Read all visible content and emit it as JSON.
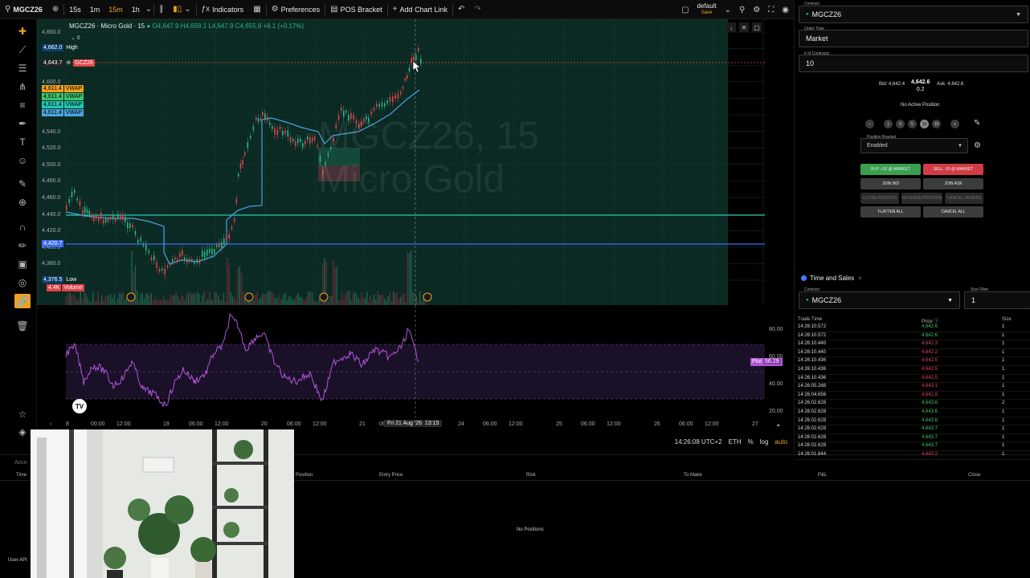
{
  "toolbar": {
    "symbol": "MGCZ26",
    "timeframes": [
      "15s",
      "1m",
      "15m",
      "1h"
    ],
    "active_timeframe": "15m",
    "indicators_label": "Indicators",
    "preferences_label": "Preferences",
    "pos_bracket_label": "POS Bracket",
    "add_chart_link_label": "Add Chart Link",
    "layout_name": "default",
    "layout_sub": "Save"
  },
  "chart": {
    "symbol_title": "MGCZ26 · Micro Gold · 15",
    "ohlc": "O4,647.9 H4,659.1 L4,647.9 C4,655.8 +8.1 (+0.17%)",
    "sub_count": "6",
    "watermark_line1": "MGCZ26, 15",
    "watermark_line2": "Micro Gold",
    "price_labels": [
      "4,660.0",
      "4,640.0",
      "4,620.0",
      "4,600.0",
      "4,580.0",
      "4,560.0",
      "4,540.0",
      "4,520.0",
      "4,500.0",
      "4,480.0",
      "4,460.0",
      "4,440.0",
      "4,420.0",
      "4,400.0",
      "4,380.0",
      "4,360.0"
    ],
    "tags": {
      "high": {
        "value": "4,662.0",
        "name": "High"
      },
      "current": {
        "value": "4,643.7",
        "name": "GCZ26"
      },
      "vwap1": {
        "value": "4,611.4",
        "name": "VWAP"
      },
      "vwap2": {
        "value": "4,611.4",
        "name": "VWAP"
      },
      "vwap3": {
        "value": "4,611.4",
        "name": "VWAP"
      },
      "vwap4": {
        "value": "4,611.4",
        "name": "VWAP"
      },
      "level": {
        "value": "4,420.7"
      },
      "low": {
        "value": "4,376.5",
        "name": "Low"
      },
      "volume": {
        "value": "4.4K",
        "name": "Volume"
      }
    },
    "colors": {
      "background": "#0c2a24",
      "up": "#2db58a",
      "down": "#e0444c",
      "vwap": "#4aa3df",
      "level_teal": "#26c6b0",
      "level_blue": "#3b6cf0"
    }
  },
  "rsi": {
    "labels": [
      "80.00",
      "60.00",
      "40.00",
      "20.00"
    ],
    "plot_label": "Plot",
    "plot_value": "56.29",
    "color": "#b057d8"
  },
  "time_axis": {
    "labels": [
      "8",
      "00:00",
      "12:00",
      "19",
      "06:00",
      "12:00",
      "20",
      "06:00",
      "12:00",
      "21",
      "06",
      "24",
      "06:00",
      "12:00",
      "25",
      "06:00",
      "12:00",
      "26",
      "06:00",
      "12:00",
      "27"
    ],
    "crosshair_date": "Fri 21 Aug '26",
    "crosshair_time": "13:15"
  },
  "status_bar": {
    "clock": "14:26:08 UTC+2",
    "session": "ETH",
    "percent": "%",
    "log": "log",
    "auto": "auto"
  },
  "order_panel": {
    "contract_label": "Contract",
    "contract_value": "MGCZ26",
    "order_type_label": "Order Type",
    "order_type_value": "Market",
    "contracts_label": "# of Contracts",
    "contracts_value": "10",
    "bid": "Bid: 4,642.4",
    "ask": "Ask: 4,642.6",
    "last_price": "4,642.6",
    "last_size": "0.2",
    "no_active_position": "No Active Position",
    "quantities": [
      "1",
      "3",
      "5",
      "10",
      "15"
    ],
    "selected_quantity": "10",
    "position_bracket_label": "Position Bracket",
    "position_bracket_value": "Enabled",
    "buy_label": "BUY +10 @ MARKET",
    "sell_label": "SELL -10 @ MARKET",
    "join_bid": "JOIN BID",
    "join_ask": "JOIN ASK",
    "close_position": "CLOSE POSITION",
    "reverse_position": "REVERSE POSITION",
    "cancel_orders": "CANCEL ORDERS",
    "flatten_all": "FLATTEN ALL",
    "cancel_all": "CANCEL ALL"
  },
  "time_and_sales": {
    "title": "Time and Sales",
    "contract_label": "Contract",
    "contract_value": "MGCZ26",
    "size_filter_label": "Size Filter",
    "size_filter_value": "1",
    "columns": [
      "Trade Time",
      "Price",
      "Size"
    ],
    "rows": [
      {
        "time": "14:26:10.572",
        "price": "4,642.6",
        "size": "1",
        "dir": "up"
      },
      {
        "time": "14:26:10.572",
        "price": "4,642.6",
        "size": "1",
        "dir": "up"
      },
      {
        "time": "14:26:10.440",
        "price": "4,642.3",
        "size": "1",
        "dir": "dn"
      },
      {
        "time": "14:26:10.440",
        "price": "4,642.2",
        "size": "1",
        "dir": "dn"
      },
      {
        "time": "14:26:10.436",
        "price": "4,642.5",
        "size": "1",
        "dir": "dn"
      },
      {
        "time": "14:26:10.436",
        "price": "4,642.5",
        "size": "1",
        "dir": "dn"
      },
      {
        "time": "14:26:10.436",
        "price": "4,642.5",
        "size": "1",
        "dir": "dn"
      },
      {
        "time": "14:26:05.268",
        "price": "4,643.1",
        "size": "1",
        "dir": "dn"
      },
      {
        "time": "14:26:04.656",
        "price": "4,642.8",
        "size": "1",
        "dir": "dn"
      },
      {
        "time": "14:26:02.628",
        "price": "4,643.6",
        "size": "2",
        "dir": "up"
      },
      {
        "time": "14:26:02.628",
        "price": "4,643.6",
        "size": "1",
        "dir": "up"
      },
      {
        "time": "14:26:02.628",
        "price": "4,643.6",
        "size": "1",
        "dir": "up"
      },
      {
        "time": "14:26:02.628",
        "price": "4,643.7",
        "size": "1",
        "dir": "up"
      },
      {
        "time": "14:26:02.628",
        "price": "4,643.7",
        "size": "1",
        "dir": "up"
      },
      {
        "time": "14:26:02.628",
        "price": "4,643.7",
        "size": "1",
        "dir": "up"
      },
      {
        "time": "14:26:01.844",
        "price": "4,643.2",
        "size": "1",
        "dir": "dn"
      }
    ]
  },
  "account_panel": {
    "tab_label": "Acco",
    "columns": [
      "Time",
      "Position",
      "Entry Price",
      "Risk",
      "To Make",
      "P&L",
      "Close"
    ],
    "empty_message": "No Positions",
    "user_api_label": "User API"
  }
}
